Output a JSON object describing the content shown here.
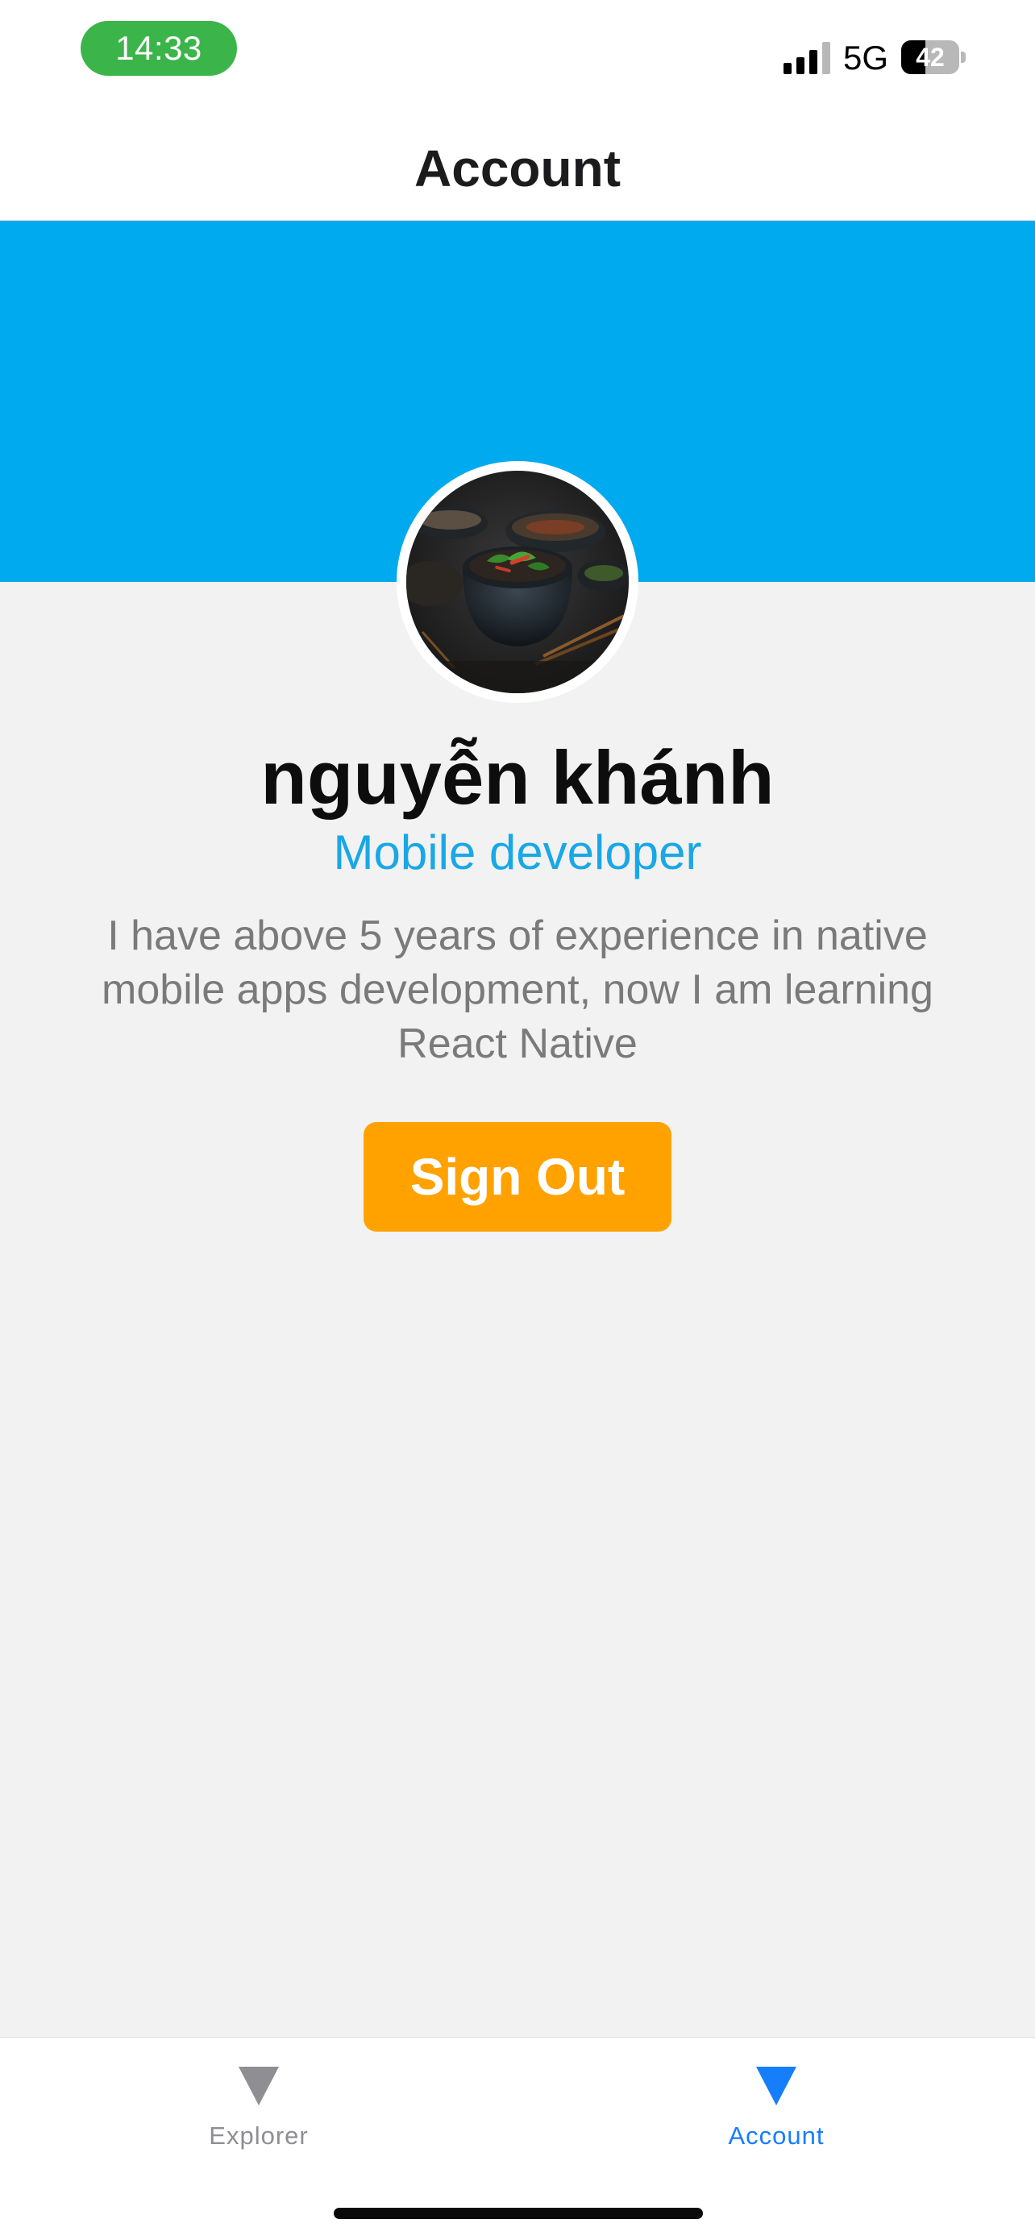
{
  "status_bar": {
    "time": "14:33",
    "network": "5G",
    "battery_level": "42",
    "battery_fraction": 0.42,
    "time_pill_color": "#3bb54a"
  },
  "header": {
    "title": "Account"
  },
  "profile": {
    "cover_color": "#00aaee",
    "avatar_icon": "avatar-photo",
    "name": "nguyễn khánh",
    "role": "Mobile developer",
    "role_color": "#1aa7e6",
    "bio": "I have above 5 years of experience in native mobile apps development, now I am learning React Native",
    "signout_label": "Sign Out",
    "signout_color": "#ffa200"
  },
  "tab_bar": {
    "tabs": [
      {
        "label": "Explorer",
        "icon": "triangle-down-icon",
        "active": false,
        "color": "#8e8e93"
      },
      {
        "label": "Account",
        "icon": "triangle-down-icon",
        "active": true,
        "color": "#157efb"
      }
    ]
  }
}
